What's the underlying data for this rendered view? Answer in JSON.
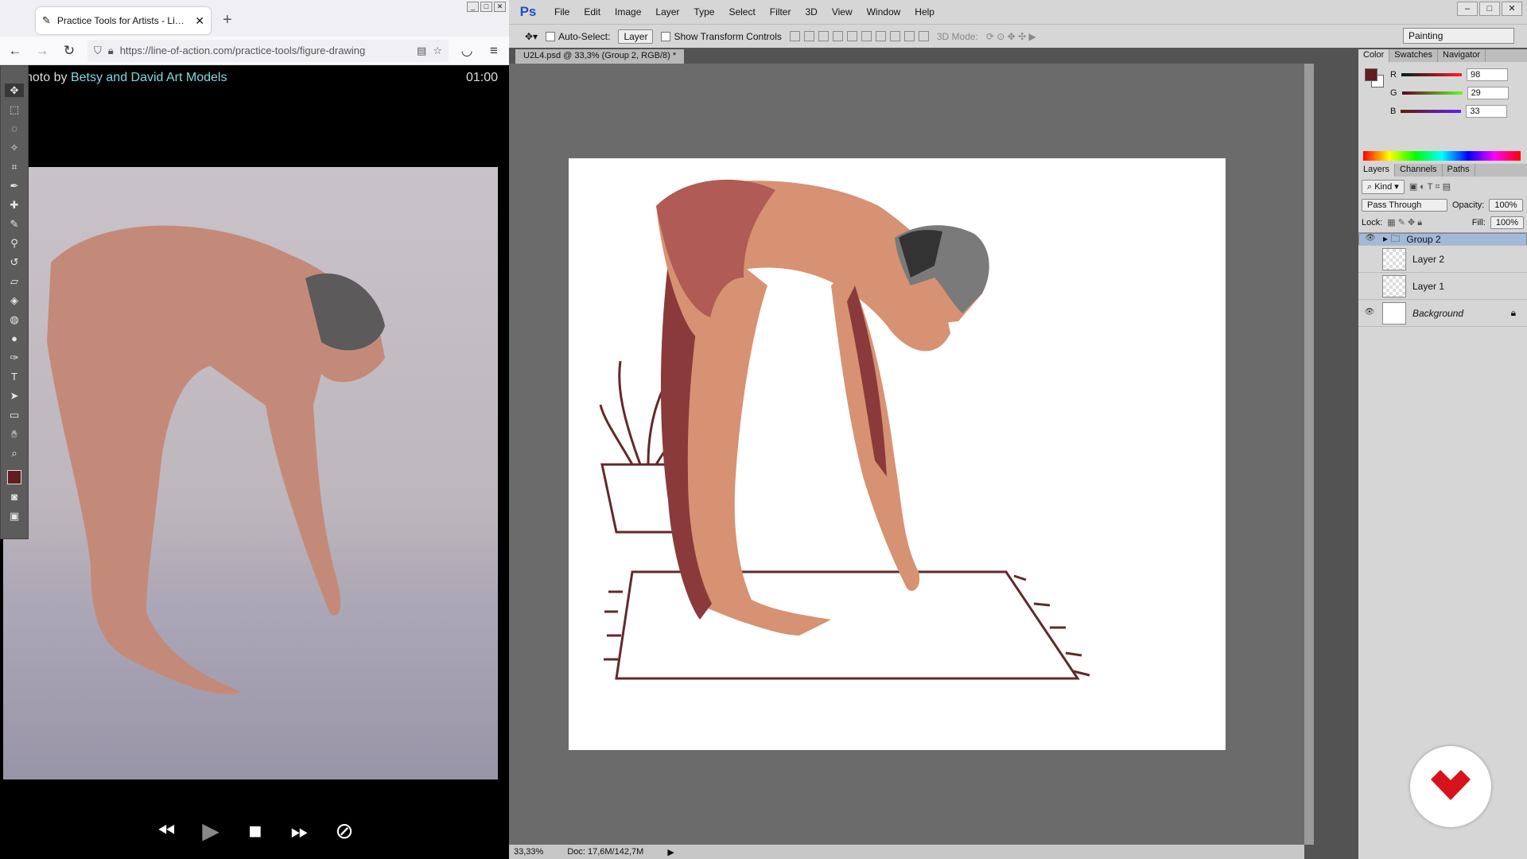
{
  "browser": {
    "tab_title": "Practice Tools for Artists - Line of Action",
    "url": "https://line-of-action.com/practice-tools/figure-drawing",
    "credit_prefix": "hoto by ",
    "credit_name": "Betsy and David Art Models",
    "timer": "01:00"
  },
  "photoshop": {
    "logo": "Ps",
    "menus": [
      "File",
      "Edit",
      "Image",
      "Layer",
      "Type",
      "Select",
      "Filter",
      "3D",
      "View",
      "Window",
      "Help"
    ],
    "options": {
      "auto_select_label": "Auto-Select:",
      "auto_select_value": "Layer",
      "transform_label": "Show Transform Controls",
      "mode_3d_label": "3D Mode:",
      "workspace": "Painting"
    },
    "document_tab": "U2L4.psd @ 33,3% (Group 2, RGB/8) *",
    "status": {
      "zoom": "33,33%",
      "doc": "Doc: 17,6M/142,7M"
    },
    "color_panel": {
      "tabs": [
        "Color",
        "Swatches",
        "Navigator"
      ],
      "r_label": "R",
      "r": "98",
      "g_label": "G",
      "g": "29",
      "b_label": "B",
      "b": "33",
      "fg_color": "#621d21"
    },
    "layers_panel": {
      "tabs": [
        "Layers",
        "Channels",
        "Paths"
      ],
      "filter": "Kind",
      "blend_mode": "Pass Through",
      "opacity_label": "Opacity:",
      "opacity": "100%",
      "lock_label": "Lock:",
      "fill_label": "Fill:",
      "fill": "100%",
      "layers": [
        "Group 2",
        "Layer 2",
        "Layer 1",
        "Background"
      ]
    }
  }
}
